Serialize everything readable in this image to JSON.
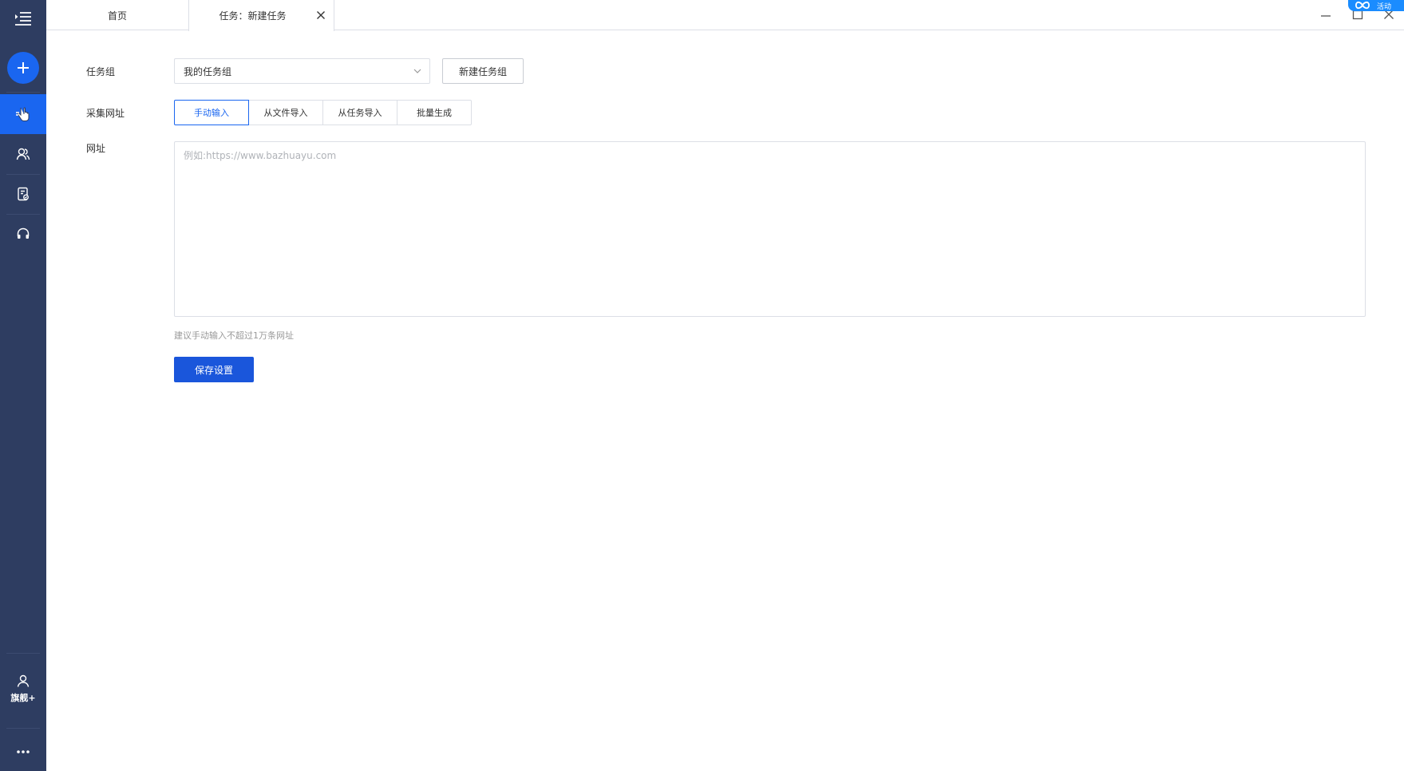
{
  "tabs": {
    "home_label": "首页",
    "active_label": "任务：新建任务"
  },
  "badge": {
    "text": "活动"
  },
  "sidebar": {
    "user_label": "旗舰+"
  },
  "form": {
    "task_group": {
      "label": "任务组",
      "value": "我的任务组",
      "new_group_button": "新建任务组"
    },
    "collect_urls": {
      "label": "采集网址",
      "options": [
        "手动输入",
        "从文件导入",
        "从任务导入",
        "批量生成"
      ],
      "selected": "手动输入"
    },
    "url": {
      "label": "网址",
      "placeholder": "例如:https://www.bazhuayu.com"
    },
    "hint": "建议手动输入不超过1万条网址",
    "save_button": "保存设置"
  },
  "colors": {
    "sidebar_bg": "#2e3d61",
    "accent": "#1a66f0",
    "primary_button": "#1a56db"
  }
}
